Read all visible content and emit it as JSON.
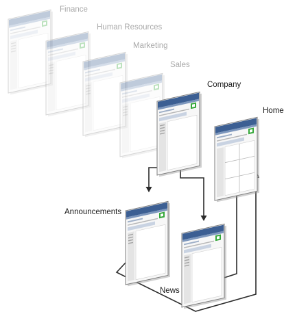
{
  "diagram": {
    "labels": {
      "finance": "Finance",
      "human_resources": "Human Resources",
      "marketing": "Marketing",
      "sales": "Sales",
      "company": "Company",
      "home": "Home",
      "announcements": "Announcements",
      "news": "News"
    },
    "colors": {
      "page_border": "#7d7d7d",
      "titlebar": "#3c5f93",
      "titlebar_light": "#7d97bd",
      "accent_green": "#35a83a",
      "canvas_bg": "#ffffff",
      "connector": "#2b2b2b",
      "faded_opacity": 0.32
    },
    "icons": {
      "page": "page-thumbnail-icon",
      "arrow": "arrowhead-icon"
    }
  }
}
